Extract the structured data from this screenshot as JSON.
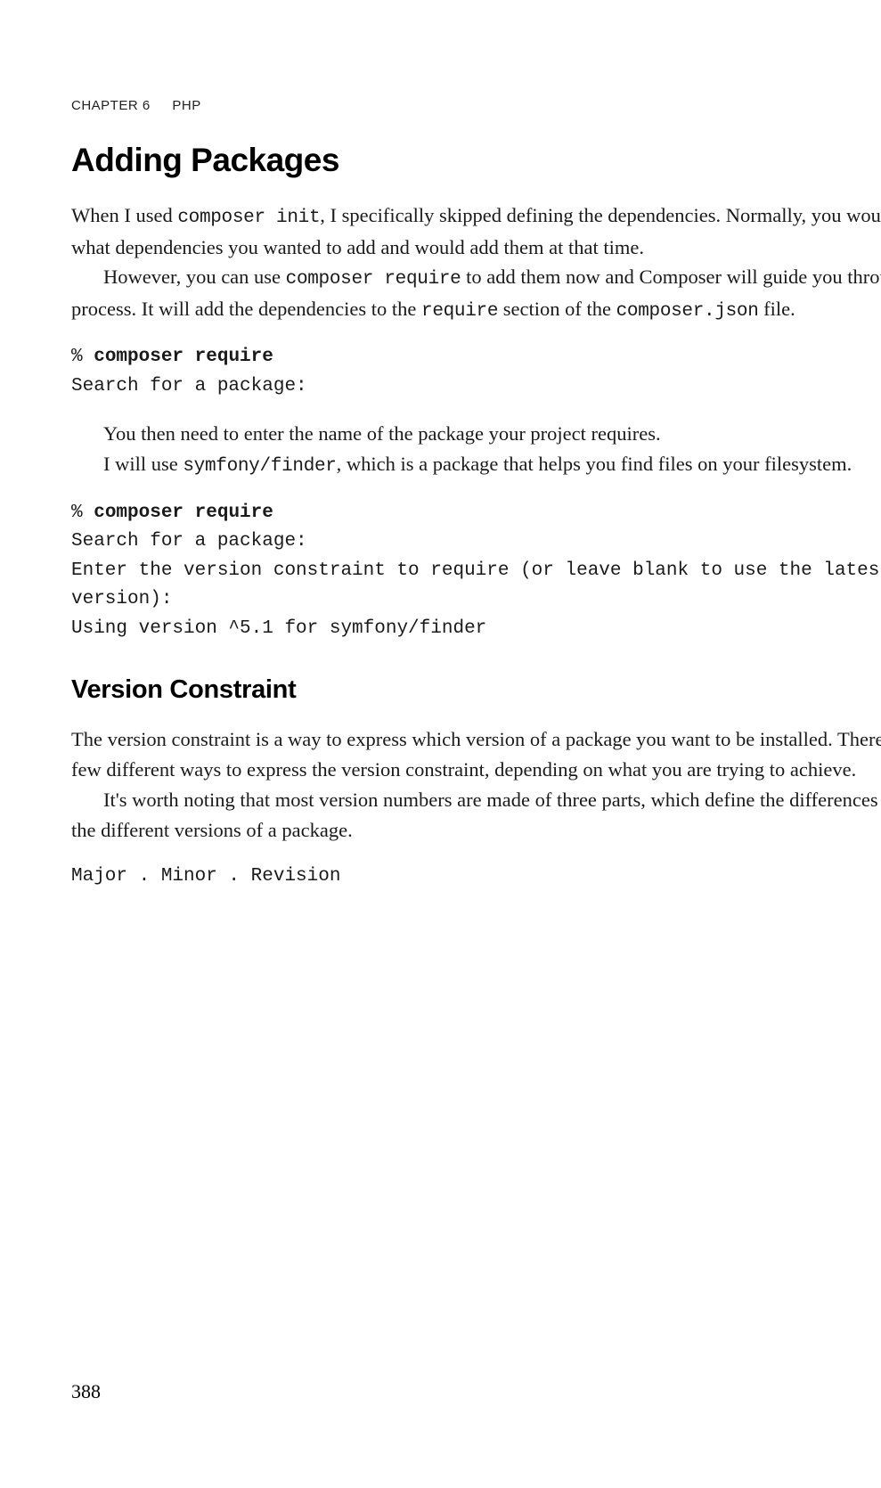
{
  "header": {
    "chapter_num": "CHAPTER 6",
    "chapter_title": "PHP"
  },
  "section": {
    "heading": "Adding Packages",
    "para1_pre": "When I used ",
    "para1_code": "composer init",
    "para1_post": ", I specifically skipped defining the dependencies. Normally, you would know what dependencies you wanted to add and would add them at that time.",
    "para2_pre": "However, you can use ",
    "para2_code": "composer require",
    "para2_mid": " to add them now and Composer will guide you through the process. It will add the dependencies to the ",
    "para2_code2": "require",
    "para2_mid2": " section of the ",
    "para2_code3": "composer.json",
    "para2_post": " file."
  },
  "code1": {
    "line1_prompt": "% ",
    "line1_cmd": "composer require",
    "line2": "Search for a package:"
  },
  "mid": {
    "para1": "You then need to enter the name of the package your project requires.",
    "para2_pre": "I will use ",
    "para2_code": "symfony/finder",
    "para2_post": ", which is a package that helps you find files on your filesystem."
  },
  "code2": {
    "line1_prompt": "% ",
    "line1_cmd": "composer require",
    "line2": "Search for a package:",
    "line3": "Enter the version constraint to require (or leave blank to use the latest version):",
    "line4": "Using version ^5.1 for symfony/finder"
  },
  "subsection": {
    "heading": "Version Constraint",
    "para1": "The version constraint is a way to express which version of a package you want to be installed. There are a few different ways to express the version constraint, depending on what you are trying to achieve.",
    "para2": "It's worth noting that most version numbers are made of three parts, which define the differences between the different versions of a package."
  },
  "code3": {
    "line1": "Major . Minor . Revision"
  },
  "page_number": "388"
}
